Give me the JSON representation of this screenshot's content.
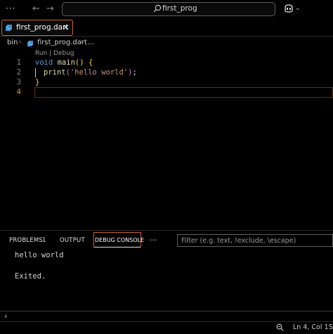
{
  "titlebar": {
    "more_label": "···",
    "back_label": "←",
    "forward_label": "→",
    "search_text": "first_prog",
    "copilot_chevron": "⌄"
  },
  "tabs": [
    {
      "label": "first_prog.dart",
      "close_label": "×",
      "active": true
    }
  ],
  "breadcrumb": {
    "folder": "bin",
    "separator": "›",
    "file": "first_prog.dart",
    "ellipsis": "..."
  },
  "editor": {
    "codelens": "Run | Debug",
    "line_numbers": [
      "1",
      "2",
      "3",
      "4"
    ],
    "current_line": 4,
    "lines": [
      [
        {
          "t": "void",
          "c": "kw"
        },
        {
          "t": " ",
          "c": "pl"
        },
        {
          "t": "main",
          "c": "fn"
        },
        {
          "t": "()",
          "c": "br1"
        },
        {
          "t": " ",
          "c": "pl"
        },
        {
          "t": "{",
          "c": "br1"
        }
      ],
      [
        {
          "t": "print",
          "c": "fn"
        },
        {
          "t": "(",
          "c": "br2"
        },
        {
          "t": "'hello world'",
          "c": "str"
        },
        {
          "t": ")",
          "c": "br2"
        },
        {
          "t": ";",
          "c": "pl"
        }
      ],
      [
        {
          "t": "}",
          "c": "br1"
        }
      ]
    ]
  },
  "panel": {
    "tabs": {
      "problems": "PROBLEMS",
      "problems_count": "1",
      "output": "OUTPUT",
      "debug_console": "DEBUG CONSOLE"
    },
    "active_tab": "DEBUG CONSOLE",
    "more_label": "···",
    "filter_placeholder": "Filter (e.g. text, !exclude, \\escape)",
    "console_lines": [
      "hello world",
      "Exited."
    ],
    "prompt": "›"
  },
  "statusbar": {
    "position": "Ln 4, Col 1",
    "spaces": "S"
  },
  "colors": {
    "background": "#000000",
    "accent_orange": "#c8642a",
    "keyword": "#569cd6",
    "function": "#dcdcaa",
    "string": "#ce9178",
    "bracket_gold": "#ffd700",
    "bracket_orchid": "#da70d6"
  },
  "icons": [
    "search-icon",
    "copilot-icon",
    "dart-file-icon",
    "zoom-icon"
  ]
}
